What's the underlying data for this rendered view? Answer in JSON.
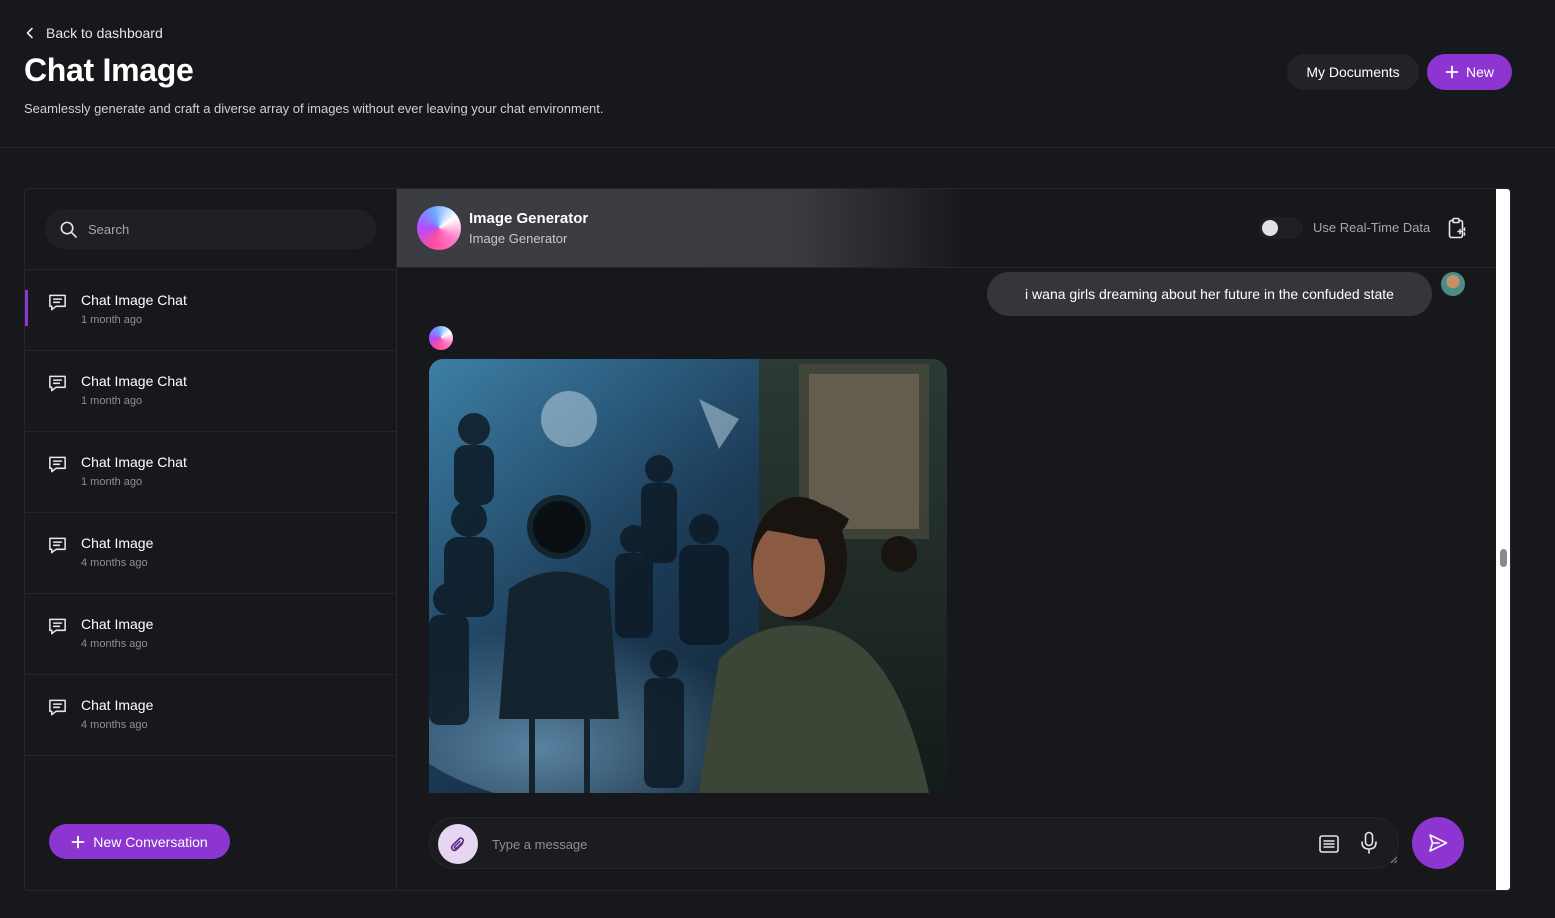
{
  "header": {
    "back_label": "Back to dashboard",
    "title": "Chat Image",
    "subtitle": "Seamlessly generate and craft a diverse array of images without ever leaving your chat environment.",
    "docs_button": "My Documents",
    "new_button": "New"
  },
  "sidebar": {
    "search_placeholder": "Search",
    "conversations": [
      {
        "title": "Chat Image Chat",
        "time": "1 month ago",
        "active": true
      },
      {
        "title": "Chat Image Chat",
        "time": "1 month ago",
        "active": false
      },
      {
        "title": "Chat Image Chat",
        "time": "1 month ago",
        "active": false
      },
      {
        "title": "Chat Image",
        "time": "4 months ago",
        "active": false
      },
      {
        "title": "Chat Image",
        "time": "4 months ago",
        "active": false
      },
      {
        "title": "Chat Image",
        "time": "4 months ago",
        "active": false
      }
    ],
    "new_conversation_button": "New Conversation"
  },
  "chat": {
    "bot_name": "Image Generator",
    "bot_subtitle": "Image Generator",
    "realtime_toggle_label": "Use Real-Time Data",
    "realtime_enabled": false,
    "user_message": "i wana girls dreaming about her future in the confuded state",
    "composer_placeholder": "Type a message"
  },
  "colors": {
    "accent": "#8c35d1",
    "background": "#17181c",
    "surface": "#1f2025",
    "border": "#25262b"
  },
  "icons": [
    "chevron-left-icon",
    "plus-icon",
    "search-icon",
    "chat-bubble-icon",
    "clipboard-icon",
    "paperclip-icon",
    "list-icon",
    "microphone-icon",
    "send-icon"
  ]
}
